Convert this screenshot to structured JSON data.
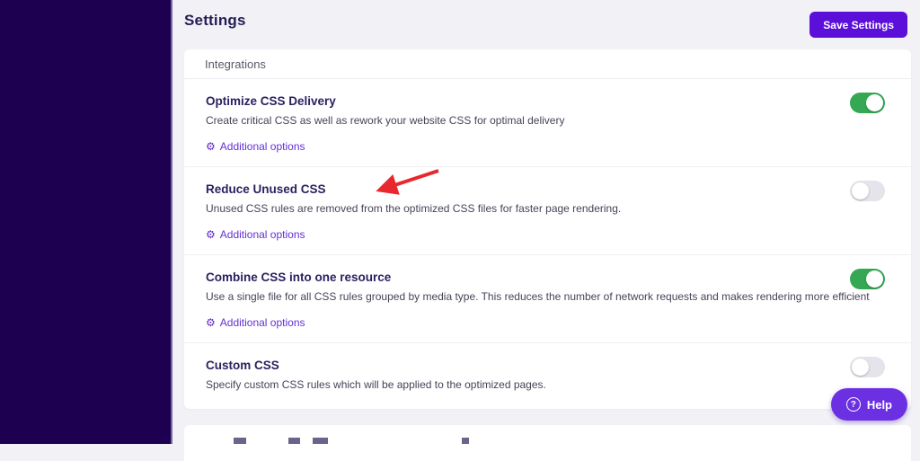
{
  "page": {
    "title": "Settings"
  },
  "header": {
    "save_button_label": "Save Settings"
  },
  "tabs": {
    "integrations_label": "Integrations"
  },
  "options": [
    {
      "title": "Optimize CSS Delivery",
      "description": "Create critical CSS as well as rework your website CSS for optimal delivery",
      "link_label": "Additional options",
      "enabled": true
    },
    {
      "title": "Reduce Unused CSS",
      "description": "Unused CSS rules are removed from the optimized CSS files for faster page rendering.",
      "link_label": "Additional options",
      "enabled": false
    },
    {
      "title": "Combine CSS into one resource",
      "description": "Use a single file for all CSS rules grouped by media type. This reduces the number of network requests and makes rendering more efficient",
      "link_label": "Additional options",
      "enabled": true
    },
    {
      "title": "Custom CSS",
      "description": "Specify custom CSS rules which will be applied to the optimized pages.",
      "enabled": false
    }
  ],
  "help": {
    "label": "Help",
    "icon_glyph": "?"
  },
  "icons": {
    "gear": "⚙"
  },
  "colors": {
    "sidebar": "#1e0050",
    "accent_button": "#5c0fd9",
    "help_button": "#6c30e3",
    "toggle_on": "#34a853",
    "toggle_off": "#e4e4ea",
    "link": "#6431d4",
    "heading": "#241d55",
    "annotation_arrow": "#e8282d"
  }
}
